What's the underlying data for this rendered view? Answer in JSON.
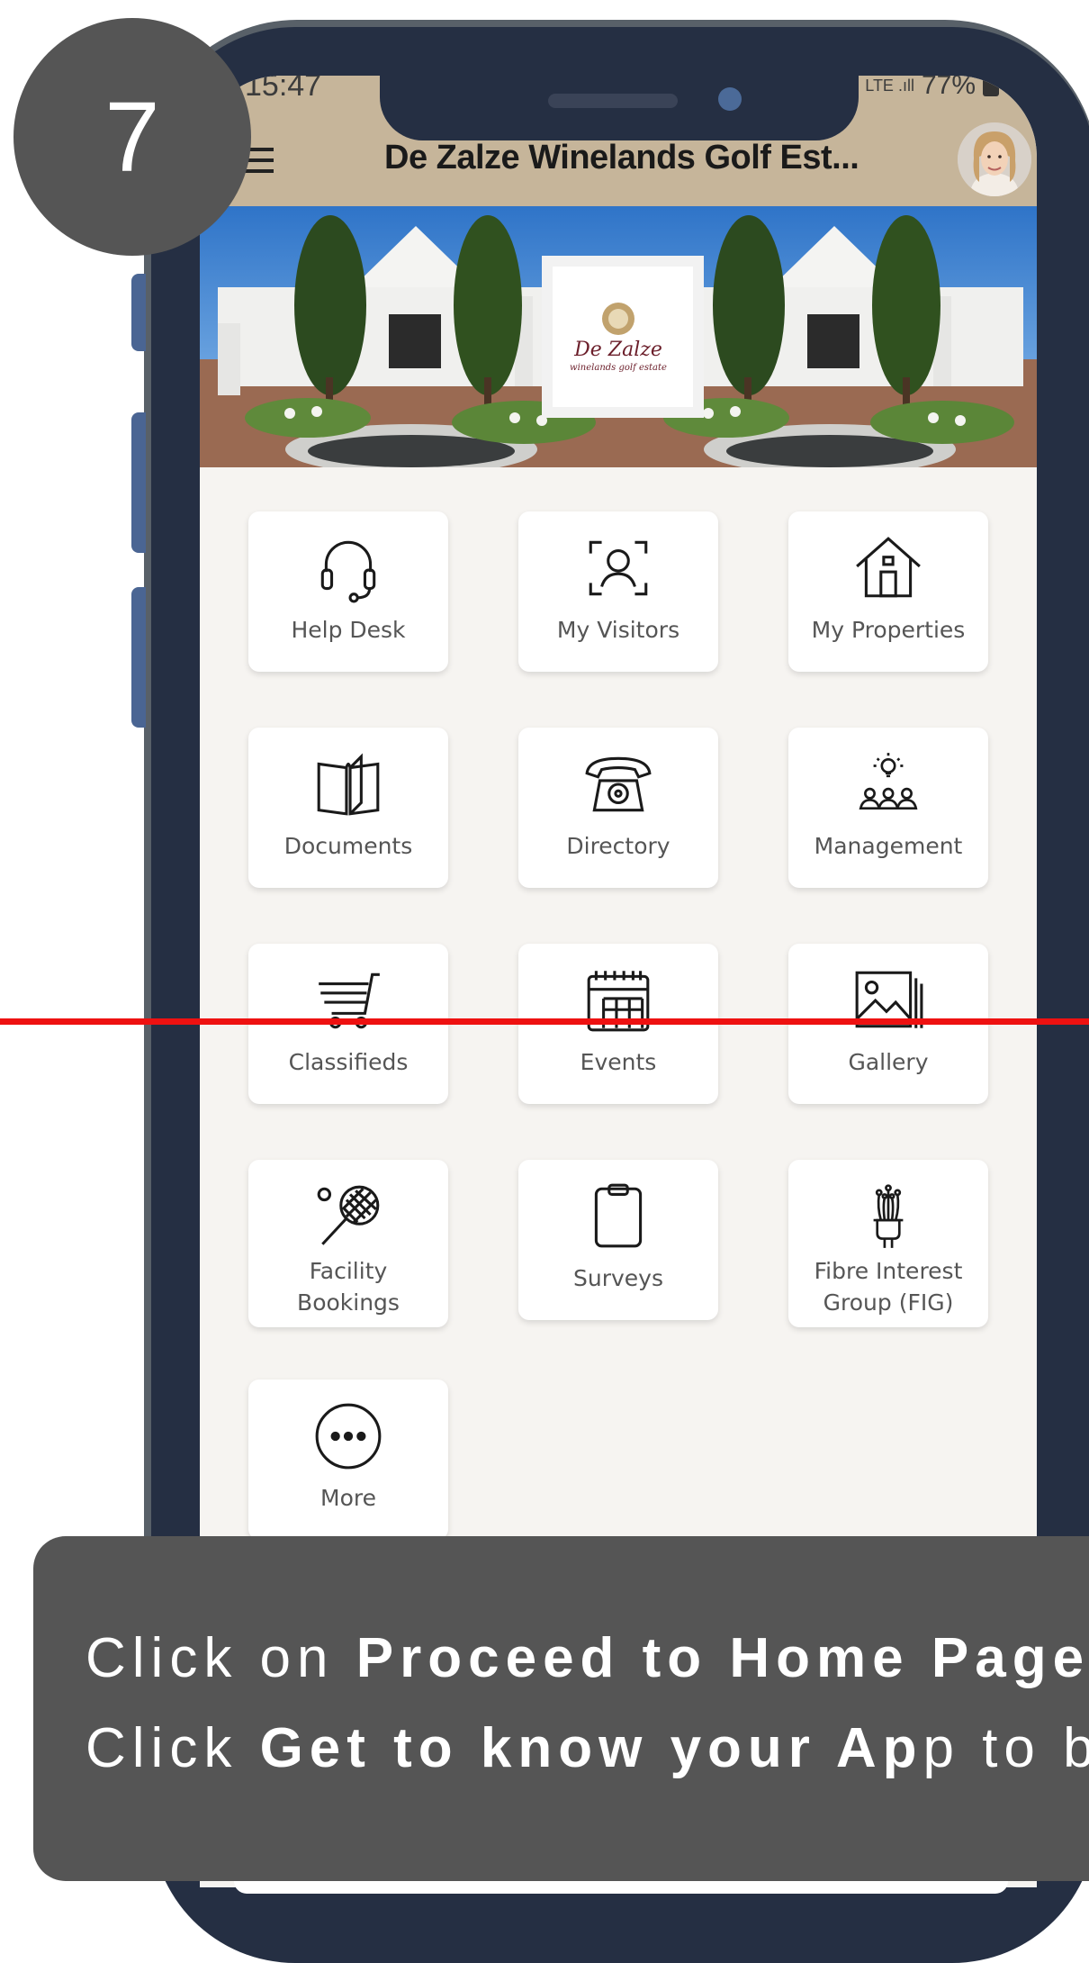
{
  "step_number": "7",
  "status_bar": {
    "time": "15:47",
    "battery": "77%",
    "signal": "LTE .ıll"
  },
  "header": {
    "title": "De Zalze Winelands Golf Est..."
  },
  "banner": {
    "logo_script": "De Zalze",
    "logo_sub": "winelands golf estate"
  },
  "tiles": [
    {
      "label": "Help Desk",
      "icon": "headset-icon"
    },
    {
      "label": "My Visitors",
      "icon": "face-scan-icon"
    },
    {
      "label": "My Properties",
      "icon": "house-icon"
    },
    {
      "label": "Documents",
      "icon": "open-book-icon"
    },
    {
      "label": "Directory",
      "icon": "telephone-icon"
    },
    {
      "label": "Management",
      "icon": "lightbulb-team-icon"
    },
    {
      "label": "Classifieds",
      "icon": "shopping-cart-icon"
    },
    {
      "label": "Events",
      "icon": "calendar-icon"
    },
    {
      "label": "Gallery",
      "icon": "image-gallery-icon"
    },
    {
      "label": "Facility\nBookings",
      "icon": "tennis-racket-icon"
    },
    {
      "label": "Surveys",
      "icon": "clipboard-icon"
    },
    {
      "label": "Fibre Interest\nGroup (FIG)",
      "icon": "fibre-cable-icon"
    },
    {
      "label": "More",
      "icon": "more-dots-icon"
    }
  ],
  "caption": {
    "line1_prefix": "Click on ",
    "line1_bold": "Proceed to Home Page",
    "line2_prefix": "Click ",
    "line2_bold": "Get to know your Ap",
    "line2_suffix": "p to be"
  },
  "colors": {
    "header": "#c6b59a",
    "phone": "#252f43",
    "overlay": "#555555",
    "accent_line": "#ee1111"
  }
}
